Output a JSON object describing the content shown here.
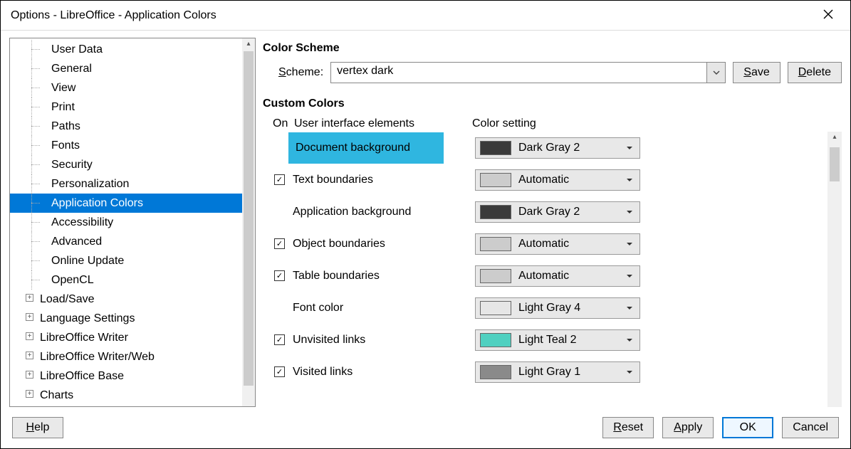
{
  "window": {
    "title": "Options - LibreOffice - Application Colors"
  },
  "tree": {
    "items": [
      {
        "label": "User Data",
        "kind": "child"
      },
      {
        "label": "General",
        "kind": "child"
      },
      {
        "label": "View",
        "kind": "child"
      },
      {
        "label": "Print",
        "kind": "child"
      },
      {
        "label": "Paths",
        "kind": "child"
      },
      {
        "label": "Fonts",
        "kind": "child"
      },
      {
        "label": "Security",
        "kind": "child"
      },
      {
        "label": "Personalization",
        "kind": "child"
      },
      {
        "label": "Application Colors",
        "kind": "child",
        "selected": true
      },
      {
        "label": "Accessibility",
        "kind": "child"
      },
      {
        "label": "Advanced",
        "kind": "child"
      },
      {
        "label": "Online Update",
        "kind": "child"
      },
      {
        "label": "OpenCL",
        "kind": "child"
      }
    ],
    "top_items": [
      {
        "label": "Load/Save"
      },
      {
        "label": "Language Settings"
      },
      {
        "label": "LibreOffice Writer"
      },
      {
        "label": "LibreOffice Writer/Web"
      },
      {
        "label": "LibreOffice Base"
      },
      {
        "label": "Charts"
      }
    ]
  },
  "scheme": {
    "section_title": "Color Scheme",
    "label_prefix": "S",
    "label_rest": "cheme:",
    "value": "vertex dark",
    "save_prefix": "S",
    "save_rest": "ave",
    "delete_prefix": "D",
    "delete_rest": "elete"
  },
  "custom": {
    "section_title": "Custom Colors",
    "header_on": "On",
    "header_uie": "User interface elements",
    "header_cs": "Color setting",
    "rows": [
      {
        "checkbox": null,
        "label": "Document background",
        "color_name": "Dark Gray 2",
        "swatch": "#3a3a3a",
        "highlighted": true
      },
      {
        "checkbox": true,
        "label": "Text boundaries",
        "color_name": "Automatic",
        "swatch": "#cccccc"
      },
      {
        "checkbox": null,
        "label": "Application background",
        "color_name": "Dark Gray 2",
        "swatch": "#3a3a3a"
      },
      {
        "checkbox": true,
        "label": "Object boundaries",
        "color_name": "Automatic",
        "swatch": "#cccccc"
      },
      {
        "checkbox": true,
        "label": "Table boundaries",
        "color_name": "Automatic",
        "swatch": "#cccccc"
      },
      {
        "checkbox": null,
        "label": "Font color",
        "color_name": "Light Gray 4",
        "swatch": "#e6e6e6"
      },
      {
        "checkbox": true,
        "label": "Unvisited links",
        "color_name": "Light Teal 2",
        "swatch": "#4fd0c0"
      },
      {
        "checkbox": true,
        "label": "Visited links",
        "color_name": "Light Gray 1",
        "swatch": "#8a8a8a"
      }
    ]
  },
  "buttons": {
    "help_prefix": "H",
    "help_rest": "elp",
    "reset_prefix": "R",
    "reset_rest": "eset",
    "apply_prefix": "A",
    "apply_rest": "pply",
    "ok": "OK",
    "cancel": "Cancel"
  }
}
